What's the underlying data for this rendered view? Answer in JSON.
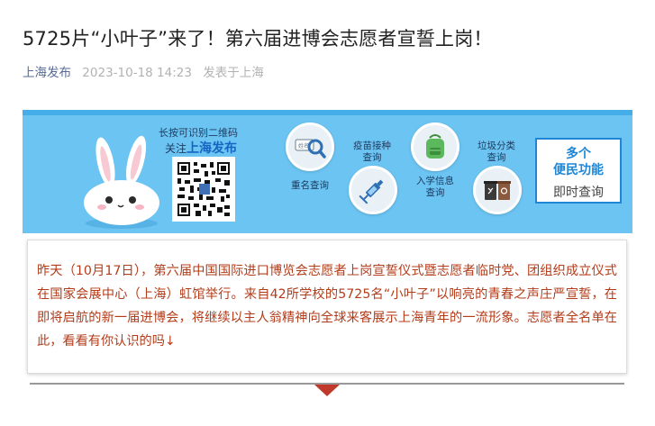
{
  "article": {
    "title": "5725片“小叶子”来了！第六届进博会志愿者宣誓上岗！",
    "source": "上海发布",
    "time": "2023-10-18 14:23",
    "published_in": "发表于上海"
  },
  "banner": {
    "qr_line1": "长按可识别二维码",
    "qr_line2_prefix": "关注",
    "qr_line2_name": "上海发布",
    "services": [
      {
        "label": "重名查询",
        "icon": "magnifier-name-icon"
      },
      {
        "label": "疫苗接种\n查询",
        "icon": "syringe-icon"
      },
      {
        "label": "入学信息\n查询",
        "icon": "backpack-icon"
      },
      {
        "label": "垃圾分类\n查询",
        "icon": "trash-bins-icon"
      }
    ],
    "more_line1": "多个",
    "more_line2": "便民功能",
    "more_line3": "即时查询",
    "name_chip": "姓名",
    "colors": {
      "background": "#6cc4f2",
      "accent": "#1f86d6"
    }
  },
  "intro": {
    "text": "昨天（10月17日），第六届中国国际进口博览会志愿者上岗宣誓仪式暨志愿者临时党、团组织成立仪式在国家会展中心（上海）虹馆举行。来自42所学校的5725名“小叶子”以响亮的青春之声庄严宣誓，在即将启航的新一届进博会，将继续以主人翁精神向全球来客展示上海青年的一流形象。志愿者全名单在此，看看有你认识的吗↓",
    "color": "#b33c1a"
  }
}
